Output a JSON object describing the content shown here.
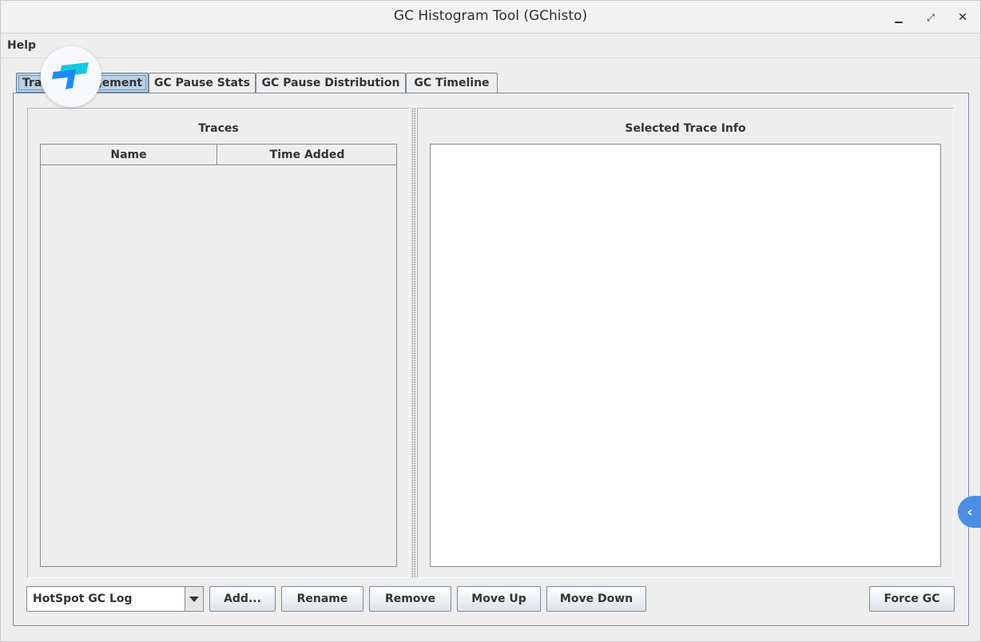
{
  "window": {
    "title": "GC Histogram Tool (GChisto)",
    "controls": {
      "minimize": "▁",
      "maximize": "⤢",
      "close": "✕"
    }
  },
  "menu": {
    "items": [
      "Help"
    ]
  },
  "tabs": [
    {
      "label": "Trace Management",
      "active": true
    },
    {
      "label": "GC Pause Stats",
      "active": false
    },
    {
      "label": "GC Pause Distribution",
      "active": false
    },
    {
      "label": "GC Timeline",
      "active": false
    }
  ],
  "traces_panel": {
    "title": "Traces",
    "columns": [
      "Name",
      "Time Added"
    ],
    "rows": []
  },
  "info_panel": {
    "title": "Selected Trace Info",
    "content": ""
  },
  "controls": {
    "trace_type": "HotSpot GC Log",
    "add_label": "Add...",
    "rename_label": "Rename",
    "remove_label": "Remove",
    "move_up_label": "Move Up",
    "move_down_label": "Move Down",
    "force_gc_label": "Force GC"
  },
  "overlay": {
    "logo_icon": "app-logo-icon",
    "side_tab_glyph": "‹"
  },
  "colors": {
    "active_tab": "#b8cfe5",
    "logo_primary": "#1a8cf0",
    "logo_secondary": "#12c8e0",
    "side_tab": "#4a8ee8"
  }
}
